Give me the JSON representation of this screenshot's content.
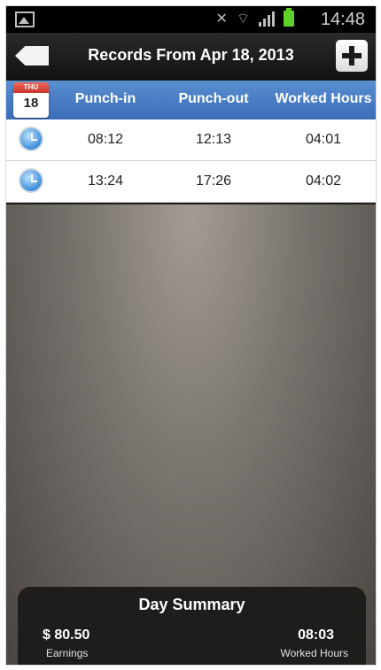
{
  "status_bar": {
    "time": "14:48"
  },
  "header": {
    "title": "Records From Apr 18, 2013"
  },
  "calendar": {
    "weekday": "THU",
    "day": "18"
  },
  "columns": [
    "Punch-in",
    "Punch-out",
    "Worked Hours"
  ],
  "records": [
    {
      "in": "08:12",
      "out": "12:13",
      "hours": "04:01"
    },
    {
      "in": "13:24",
      "out": "17:26",
      "hours": "04:02"
    }
  ],
  "summary": {
    "title": "Day Summary",
    "earnings_value": "$ 80.50",
    "earnings_label": "Earnings",
    "hours_value": "08:03",
    "hours_label": "Worked Hours"
  },
  "colors": {
    "header_blue": "#3a6cb7",
    "battery": "#5fcf2a"
  }
}
